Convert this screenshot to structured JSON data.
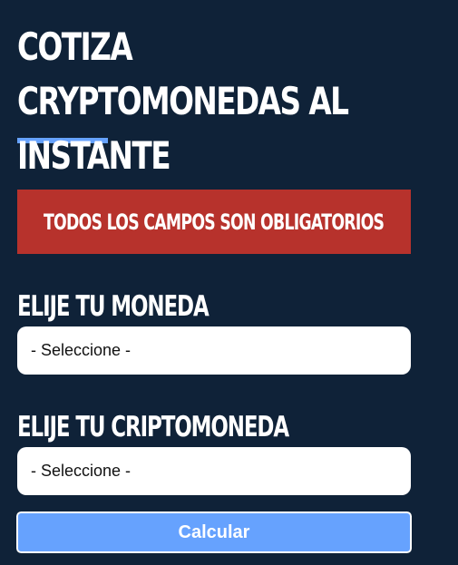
{
  "header": {
    "title": "Cotiza Cryptomonedas al Instante"
  },
  "error": {
    "message": "Todos los campos son obligatorios"
  },
  "form": {
    "currency_label": "Elije tu Moneda",
    "currency_value": "- Seleccione -",
    "crypto_label": "Elije tu Criptomoneda",
    "crypto_value": "- Seleccione -",
    "submit_label": "Calcular"
  },
  "colors": {
    "background": "#0f2238",
    "accent": "#66a2fe",
    "error": "#b7322c"
  }
}
